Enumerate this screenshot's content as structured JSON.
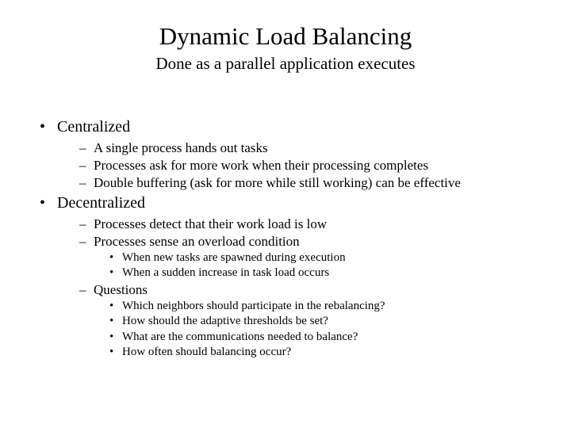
{
  "title": "Dynamic Load Balancing",
  "subtitle": "Done as a parallel application executes",
  "centralized": {
    "heading": "Centralized",
    "items": [
      "A single process hands out tasks",
      "Processes ask for more work when their processing completes",
      "Double buffering (ask for more while still working) can be effective"
    ]
  },
  "decentralized": {
    "heading": "Decentralized",
    "items": [
      "Processes detect that their work load is low",
      "Processes sense an overload condition"
    ],
    "overload_sub": [
      "When new tasks are spawned during execution",
      "When a sudden increase in task load occurs"
    ],
    "questions_label": "Questions",
    "questions": [
      "Which neighbors should participate in the rebalancing?",
      "How should the adaptive thresholds be set?",
      "What are the communications needed to balance?",
      "How often should balancing occur?"
    ]
  }
}
